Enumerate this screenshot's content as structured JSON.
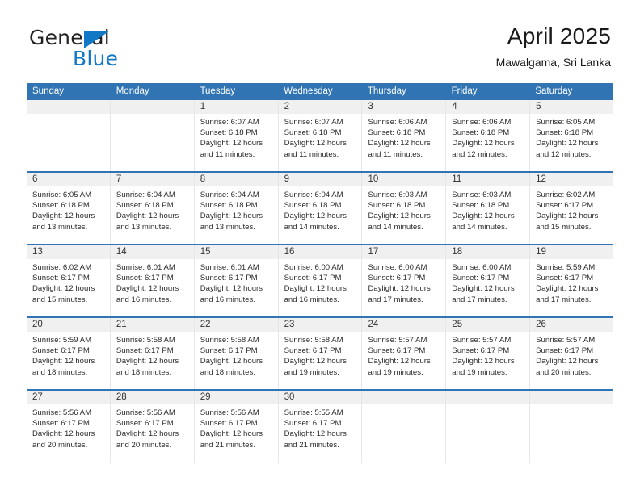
{
  "brand": {
    "name_part1": "General",
    "name_part2": "Blue",
    "accent_color": "#1277c4"
  },
  "header": {
    "title": "April 2025",
    "location": "Mawalgama, Sri Lanka",
    "header_bg": "#3174b4"
  },
  "weekdays": [
    "Sunday",
    "Monday",
    "Tuesday",
    "Wednesday",
    "Thursday",
    "Friday",
    "Saturday"
  ],
  "weeks": [
    [
      {
        "day": ""
      },
      {
        "day": ""
      },
      {
        "day": "1",
        "sunrise": "Sunrise: 6:07 AM",
        "sunset": "Sunset: 6:18 PM",
        "daylight_line1": "Daylight: 12 hours",
        "daylight_line2": "and 11 minutes."
      },
      {
        "day": "2",
        "sunrise": "Sunrise: 6:07 AM",
        "sunset": "Sunset: 6:18 PM",
        "daylight_line1": "Daylight: 12 hours",
        "daylight_line2": "and 11 minutes."
      },
      {
        "day": "3",
        "sunrise": "Sunrise: 6:06 AM",
        "sunset": "Sunset: 6:18 PM",
        "daylight_line1": "Daylight: 12 hours",
        "daylight_line2": "and 11 minutes."
      },
      {
        "day": "4",
        "sunrise": "Sunrise: 6:06 AM",
        "sunset": "Sunset: 6:18 PM",
        "daylight_line1": "Daylight: 12 hours",
        "daylight_line2": "and 12 minutes."
      },
      {
        "day": "5",
        "sunrise": "Sunrise: 6:05 AM",
        "sunset": "Sunset: 6:18 PM",
        "daylight_line1": "Daylight: 12 hours",
        "daylight_line2": "and 12 minutes."
      }
    ],
    [
      {
        "day": "6",
        "sunrise": "Sunrise: 6:05 AM",
        "sunset": "Sunset: 6:18 PM",
        "daylight_line1": "Daylight: 12 hours",
        "daylight_line2": "and 13 minutes."
      },
      {
        "day": "7",
        "sunrise": "Sunrise: 6:04 AM",
        "sunset": "Sunset: 6:18 PM",
        "daylight_line1": "Daylight: 12 hours",
        "daylight_line2": "and 13 minutes."
      },
      {
        "day": "8",
        "sunrise": "Sunrise: 6:04 AM",
        "sunset": "Sunset: 6:18 PM",
        "daylight_line1": "Daylight: 12 hours",
        "daylight_line2": "and 13 minutes."
      },
      {
        "day": "9",
        "sunrise": "Sunrise: 6:04 AM",
        "sunset": "Sunset: 6:18 PM",
        "daylight_line1": "Daylight: 12 hours",
        "daylight_line2": "and 14 minutes."
      },
      {
        "day": "10",
        "sunrise": "Sunrise: 6:03 AM",
        "sunset": "Sunset: 6:18 PM",
        "daylight_line1": "Daylight: 12 hours",
        "daylight_line2": "and 14 minutes."
      },
      {
        "day": "11",
        "sunrise": "Sunrise: 6:03 AM",
        "sunset": "Sunset: 6:18 PM",
        "daylight_line1": "Daylight: 12 hours",
        "daylight_line2": "and 14 minutes."
      },
      {
        "day": "12",
        "sunrise": "Sunrise: 6:02 AM",
        "sunset": "Sunset: 6:17 PM",
        "daylight_line1": "Daylight: 12 hours",
        "daylight_line2": "and 15 minutes."
      }
    ],
    [
      {
        "day": "13",
        "sunrise": "Sunrise: 6:02 AM",
        "sunset": "Sunset: 6:17 PM",
        "daylight_line1": "Daylight: 12 hours",
        "daylight_line2": "and 15 minutes."
      },
      {
        "day": "14",
        "sunrise": "Sunrise: 6:01 AM",
        "sunset": "Sunset: 6:17 PM",
        "daylight_line1": "Daylight: 12 hours",
        "daylight_line2": "and 16 minutes."
      },
      {
        "day": "15",
        "sunrise": "Sunrise: 6:01 AM",
        "sunset": "Sunset: 6:17 PM",
        "daylight_line1": "Daylight: 12 hours",
        "daylight_line2": "and 16 minutes."
      },
      {
        "day": "16",
        "sunrise": "Sunrise: 6:00 AM",
        "sunset": "Sunset: 6:17 PM",
        "daylight_line1": "Daylight: 12 hours",
        "daylight_line2": "and 16 minutes."
      },
      {
        "day": "17",
        "sunrise": "Sunrise: 6:00 AM",
        "sunset": "Sunset: 6:17 PM",
        "daylight_line1": "Daylight: 12 hours",
        "daylight_line2": "and 17 minutes."
      },
      {
        "day": "18",
        "sunrise": "Sunrise: 6:00 AM",
        "sunset": "Sunset: 6:17 PM",
        "daylight_line1": "Daylight: 12 hours",
        "daylight_line2": "and 17 minutes."
      },
      {
        "day": "19",
        "sunrise": "Sunrise: 5:59 AM",
        "sunset": "Sunset: 6:17 PM",
        "daylight_line1": "Daylight: 12 hours",
        "daylight_line2": "and 17 minutes."
      }
    ],
    [
      {
        "day": "20",
        "sunrise": "Sunrise: 5:59 AM",
        "sunset": "Sunset: 6:17 PM",
        "daylight_line1": "Daylight: 12 hours",
        "daylight_line2": "and 18 minutes."
      },
      {
        "day": "21",
        "sunrise": "Sunrise: 5:58 AM",
        "sunset": "Sunset: 6:17 PM",
        "daylight_line1": "Daylight: 12 hours",
        "daylight_line2": "and 18 minutes."
      },
      {
        "day": "22",
        "sunrise": "Sunrise: 5:58 AM",
        "sunset": "Sunset: 6:17 PM",
        "daylight_line1": "Daylight: 12 hours",
        "daylight_line2": "and 18 minutes."
      },
      {
        "day": "23",
        "sunrise": "Sunrise: 5:58 AM",
        "sunset": "Sunset: 6:17 PM",
        "daylight_line1": "Daylight: 12 hours",
        "daylight_line2": "and 19 minutes."
      },
      {
        "day": "24",
        "sunrise": "Sunrise: 5:57 AM",
        "sunset": "Sunset: 6:17 PM",
        "daylight_line1": "Daylight: 12 hours",
        "daylight_line2": "and 19 minutes."
      },
      {
        "day": "25",
        "sunrise": "Sunrise: 5:57 AM",
        "sunset": "Sunset: 6:17 PM",
        "daylight_line1": "Daylight: 12 hours",
        "daylight_line2": "and 19 minutes."
      },
      {
        "day": "26",
        "sunrise": "Sunrise: 5:57 AM",
        "sunset": "Sunset: 6:17 PM",
        "daylight_line1": "Daylight: 12 hours",
        "daylight_line2": "and 20 minutes."
      }
    ],
    [
      {
        "day": "27",
        "sunrise": "Sunrise: 5:56 AM",
        "sunset": "Sunset: 6:17 PM",
        "daylight_line1": "Daylight: 12 hours",
        "daylight_line2": "and 20 minutes."
      },
      {
        "day": "28",
        "sunrise": "Sunrise: 5:56 AM",
        "sunset": "Sunset: 6:17 PM",
        "daylight_line1": "Daylight: 12 hours",
        "daylight_line2": "and 20 minutes."
      },
      {
        "day": "29",
        "sunrise": "Sunrise: 5:56 AM",
        "sunset": "Sunset: 6:17 PM",
        "daylight_line1": "Daylight: 12 hours",
        "daylight_line2": "and 21 minutes."
      },
      {
        "day": "30",
        "sunrise": "Sunrise: 5:55 AM",
        "sunset": "Sunset: 6:17 PM",
        "daylight_line1": "Daylight: 12 hours",
        "daylight_line2": "and 21 minutes."
      },
      {
        "day": ""
      },
      {
        "day": ""
      },
      {
        "day": ""
      }
    ]
  ]
}
